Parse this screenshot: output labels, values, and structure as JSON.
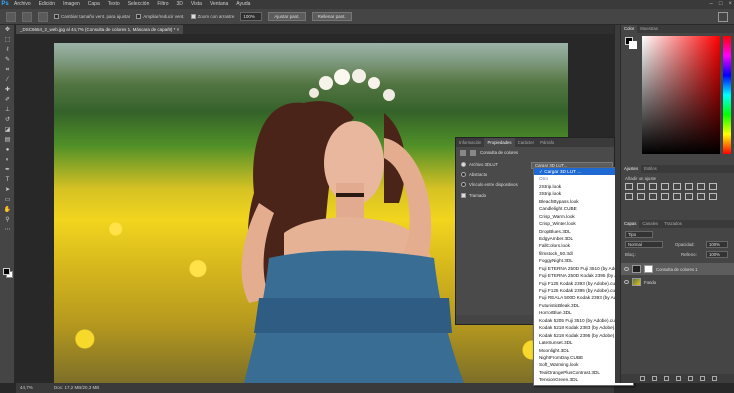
{
  "menubar": {
    "logo": "Ps",
    "items": [
      "Archivo",
      "Edición",
      "Imagen",
      "Capa",
      "Texto",
      "Selección",
      "Filtro",
      "3D",
      "Vista",
      "Ventana",
      "Ayuda"
    ],
    "window_controls": [
      "–",
      "□",
      "×"
    ]
  },
  "options_bar": {
    "resize_windows_label": "Cambiar tamaño vent. para ajustar",
    "zoom_all_label": "Ampliar/reducir vent.",
    "scrubby_zoom_label": "Zoom con arrastre",
    "zoom_value": "100%",
    "fit_screen_label": "Ajustar pant.",
    "fill_screen_label": "Rellenar pant."
  },
  "document": {
    "tab_title": "_DSC6654_2_web.jpg al 44,7% (Consulta de colores 1, Máscara de capa/8) *",
    "close_glyph": "×"
  },
  "status_bar": {
    "zoom": "44,7%",
    "doc_info": "Doc: 17,2 MB/20,3 MB"
  },
  "properties_panel": {
    "tabs": [
      "Información",
      "Propiedades",
      "Carácter",
      "Párrafo"
    ],
    "active_tab": "Propiedades",
    "title": "Consulta de colores",
    "options": {
      "file_3dlut": "Archivo 3DLUT",
      "abstract": "Abstracto",
      "device_link": "Vínculo entre dispositivos",
      "dither": "Tramado"
    },
    "select_value": "Cargar 3D LUT..."
  },
  "lut_dropdown": {
    "selected": "✓ Cargar 3D LUT ...",
    "other_label": "Otro",
    "items": [
      "2Strip.look",
      "3Strip.look",
      "BleachBypass.look",
      "Candlelight.CUBE",
      "Crisp_Warm.look",
      "Crisp_Winter.look",
      "DropBlues.3DL",
      "EdgyAmber.3DL",
      "FallColors.look",
      "filmstock_50.3dl",
      "FoggyNight.3DL",
      "Fuji ETERNA 250D Fuji 3510 (by Adobe).cube",
      "Fuji ETERNA 250D Kodak 2395 (by Adobe).cube",
      "Fuji F125 Kodak 2393 (by Adobe).cube",
      "Fuji F125 Kodak 2395 (by Adobe).cube",
      "Fuji REALA 500D Kodak 2393 (by Adobe).cube",
      "FuturisticBleak.3DL",
      "HorrorBlue.3DL",
      "Kodak 5205 Fuji 3510 (by Adobe).cube",
      "Kodak 5218 Kodak 2383 (by Adobe).cube",
      "Kodak 5218 Kodak 2395 (by Adobe).cube",
      "LateSunset.3DL",
      "Moonlight.3DL",
      "NightFromDay.CUBE",
      "Soft_Warming.look",
      "TealOrangePlusContrast.3DL",
      "TensionGreen.3DL"
    ]
  },
  "color_panel": {
    "tabs": [
      "Color",
      "Muestras"
    ],
    "active_tab": "Color"
  },
  "adjustments_panel": {
    "tabs": [
      "Ajustes",
      "Estilos"
    ],
    "add_label": "Añadir un ajuste"
  },
  "layers_panel": {
    "tabs": [
      "Capas",
      "Canales",
      "Trazados"
    ],
    "kind_filter": "Tipo",
    "blend_mode": "Normal",
    "opacity_label": "Opacidad:",
    "opacity_value": "100%",
    "lock_label": "Bloq.:",
    "fill_label": "Relleno:",
    "fill_value": "100%",
    "layers": [
      "Consulta de colores 1",
      "Fondo"
    ]
  },
  "colors": {
    "selection_blue": "#1e69d2",
    "ps_blue": "#31a8ff"
  }
}
